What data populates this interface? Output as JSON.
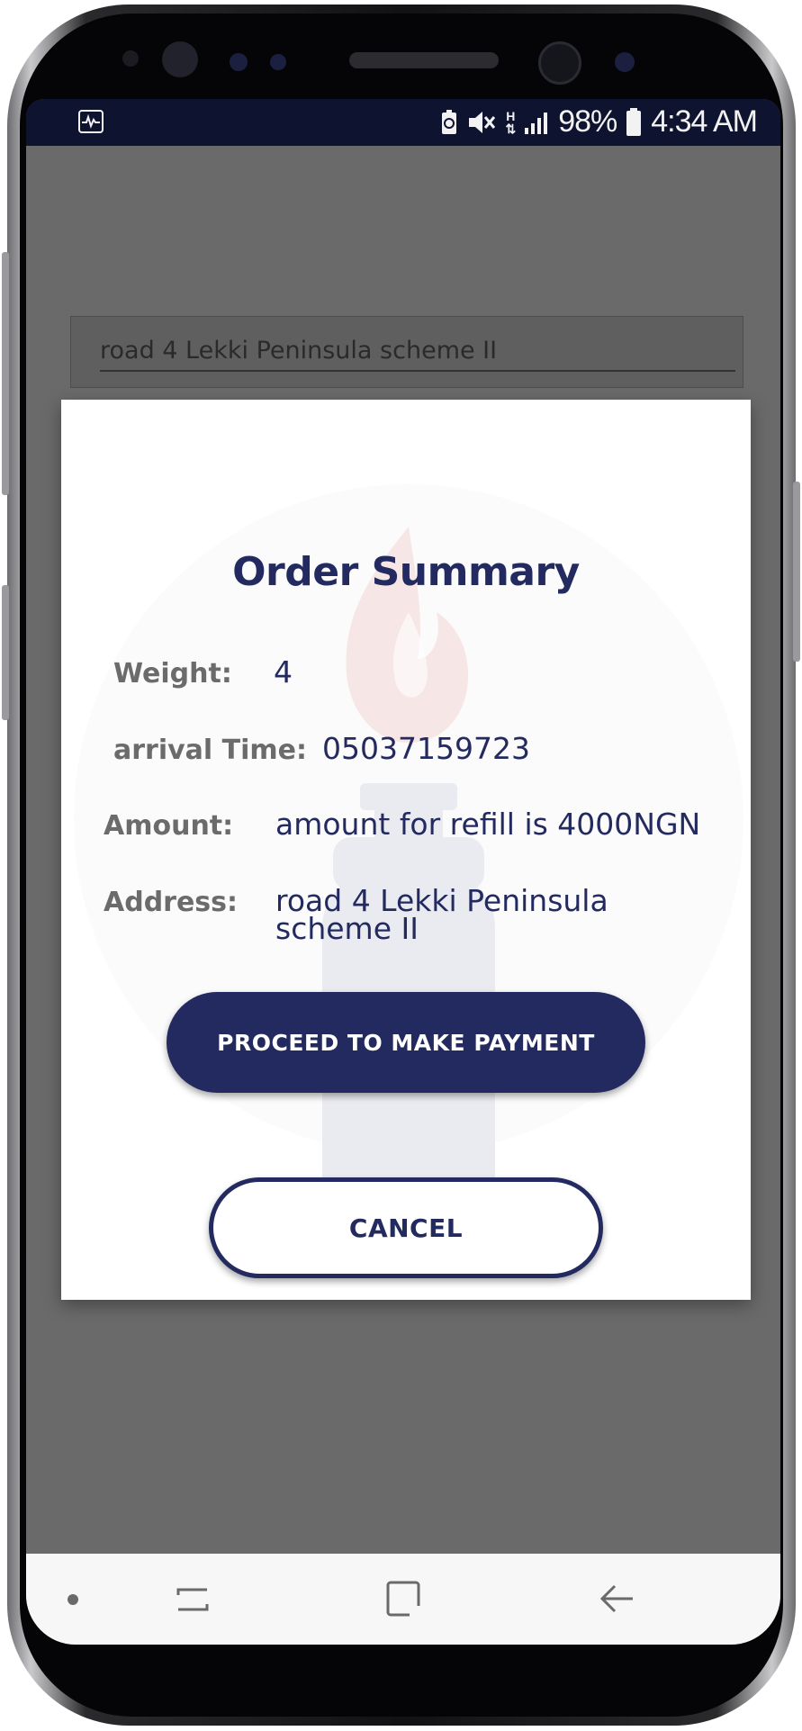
{
  "status_bar": {
    "battery_percent": "98%",
    "time": "4:34 AM",
    "network_letter": "H",
    "icons": [
      "activity-icon",
      "battery-saver-icon",
      "mute-icon",
      "network-h-icon",
      "signal-icon",
      "battery-icon"
    ]
  },
  "background": {
    "address_value": "road 4 Lekki Peninsula scheme II"
  },
  "dialog": {
    "title": "Order Summary",
    "weight_label": "Weight:",
    "weight_value": "4",
    "arrival_label": "arrival Time:",
    "arrival_value": "05037159723",
    "amount_label": "Amount:",
    "amount_value": "amount for refill is 4000NGN",
    "address_label": "Address:",
    "address_value_line1": "road 4 Lekki Peninsula",
    "address_value_line2": "scheme II",
    "proceed_label": "PROCEED TO MAKE PAYMENT",
    "cancel_label": "CANCEL"
  },
  "nav_bar": {
    "icons": [
      "nav-dot-icon",
      "recents-icon",
      "home-icon",
      "back-icon"
    ]
  },
  "colors": {
    "primary": "#232a5f",
    "label_gray": "#6b6b6b",
    "dim_overlay": "#6a6a6a",
    "status_bar": "#0e1330"
  }
}
